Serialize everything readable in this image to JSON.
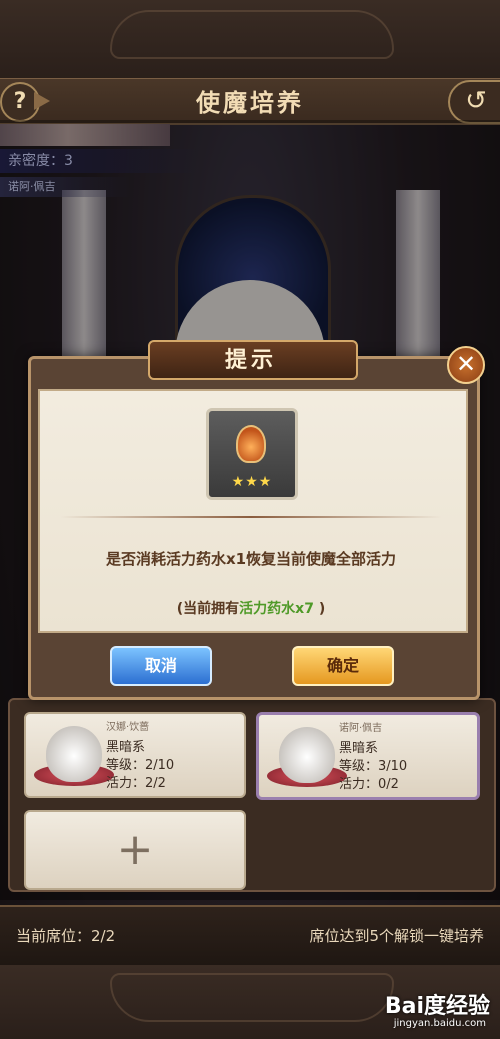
{
  "header": {
    "title": "使魔培养",
    "help_label": "?",
    "back_label": "↺"
  },
  "info": {
    "intimacy": "亲密度：3",
    "familiar_name": "诺阿·佩吉"
  },
  "dialog": {
    "title": "提示",
    "close_label": "✕",
    "item_stars": "★★★",
    "message": "是否消耗活力药水x1恢复当前使魔全部活力",
    "owned_prefix": "(当前拥有",
    "owned_item": "活力药水x7",
    "owned_suffix": " )",
    "cancel_label": "取消",
    "confirm_label": "确定"
  },
  "cards": [
    {
      "name": "汉娜·饮蔷",
      "type": "黑暗系",
      "level": "等级：2/10",
      "energy": "活力：2/2"
    },
    {
      "name": "诺阿·佩吉",
      "type": "黑暗系",
      "level": "等级：3/10",
      "energy": "活力：0/2"
    }
  ],
  "add_label": "+",
  "seat": {
    "current": "当前席位：2/2",
    "unlock_hint": "席位达到5个解锁一键培养"
  },
  "watermark": {
    "brand": "Bai度经验",
    "url": "jingyan.baidu.com"
  },
  "colors": {
    "accent_gold": "#e59820",
    "cancel_blue": "#2c6fd1",
    "green_text": "#4f9a28"
  }
}
